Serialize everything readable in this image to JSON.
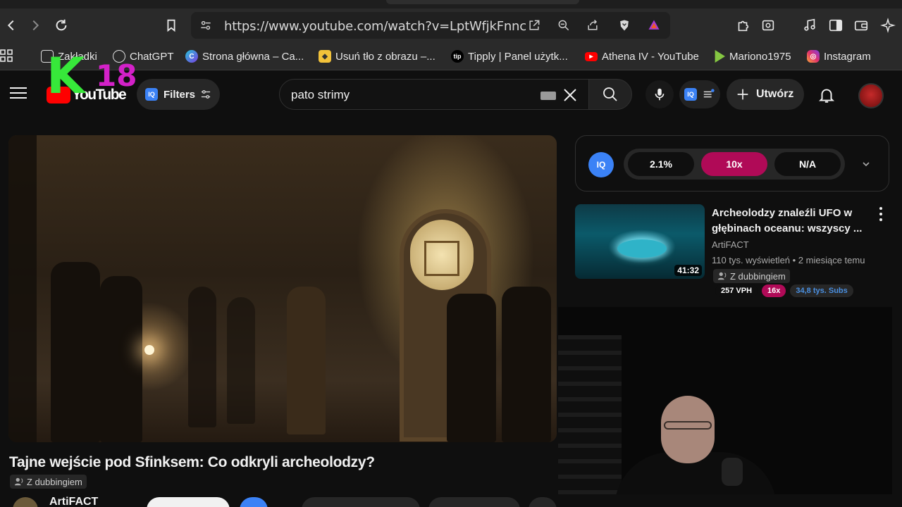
{
  "browser": {
    "url": "https://www.youtube.com/watch?v=LptWfjkFnnc",
    "bookmarks": [
      {
        "label": "Zakładki",
        "icon": "bookmark-folder-icon"
      },
      {
        "label": "ChatGPT",
        "icon": "chatgpt-icon"
      },
      {
        "label": "Strona główna – Ca...",
        "icon": "canva-icon"
      },
      {
        "label": "Usuń tło z obrazu –...",
        "icon": "remove-bg-icon"
      },
      {
        "label": "Tipply | Panel użytk...",
        "icon": "tipply-icon"
      },
      {
        "label": "Athena IV - YouTube",
        "icon": "youtube-icon"
      },
      {
        "label": "Mariono1975",
        "icon": "rumble-icon"
      },
      {
        "label": "Instagram",
        "icon": "instagram-icon"
      }
    ],
    "bookmark_icon_text": {
      "tipply": "tip"
    }
  },
  "overlay": {
    "k18_letter": "K",
    "k18_number": "18"
  },
  "masthead": {
    "logo_text": "YouTube",
    "filters_label": "Filters",
    "iq_badge": "IQ",
    "search_query": "pato strimy",
    "create_label": "Utwórz"
  },
  "video": {
    "title": "Tajne wejście pod Sfinksem: Co odkryli archeolodzy?",
    "dubbed_label": "Z dubbingiem",
    "channel": "ArtiFACT"
  },
  "iq_panel": {
    "logo": "IQ",
    "stat1": "2.1%",
    "stat2": "10x",
    "stat3": "N/A"
  },
  "recommendation": {
    "title": "Archeolodzy znaleźli UFO w głębinach oceanu: wszyscy ...",
    "channel": "ArtiFACT",
    "meta": "110 tys. wyświetleń • 2 miesiące temu",
    "duration": "41:32",
    "dubbed_label": "Z dubbingiem",
    "vph": "257 VPH",
    "multiplier": "16x",
    "subs": "34,8 tys. Subs"
  },
  "colors": {
    "accent_red": "#ff0000",
    "iq_blue": "#3b82f6",
    "multiplier_pink": "#b00a57",
    "subs_blue": "#4a90e2",
    "k18_green": "#37e83a",
    "k18_magenta": "#d321c8"
  }
}
